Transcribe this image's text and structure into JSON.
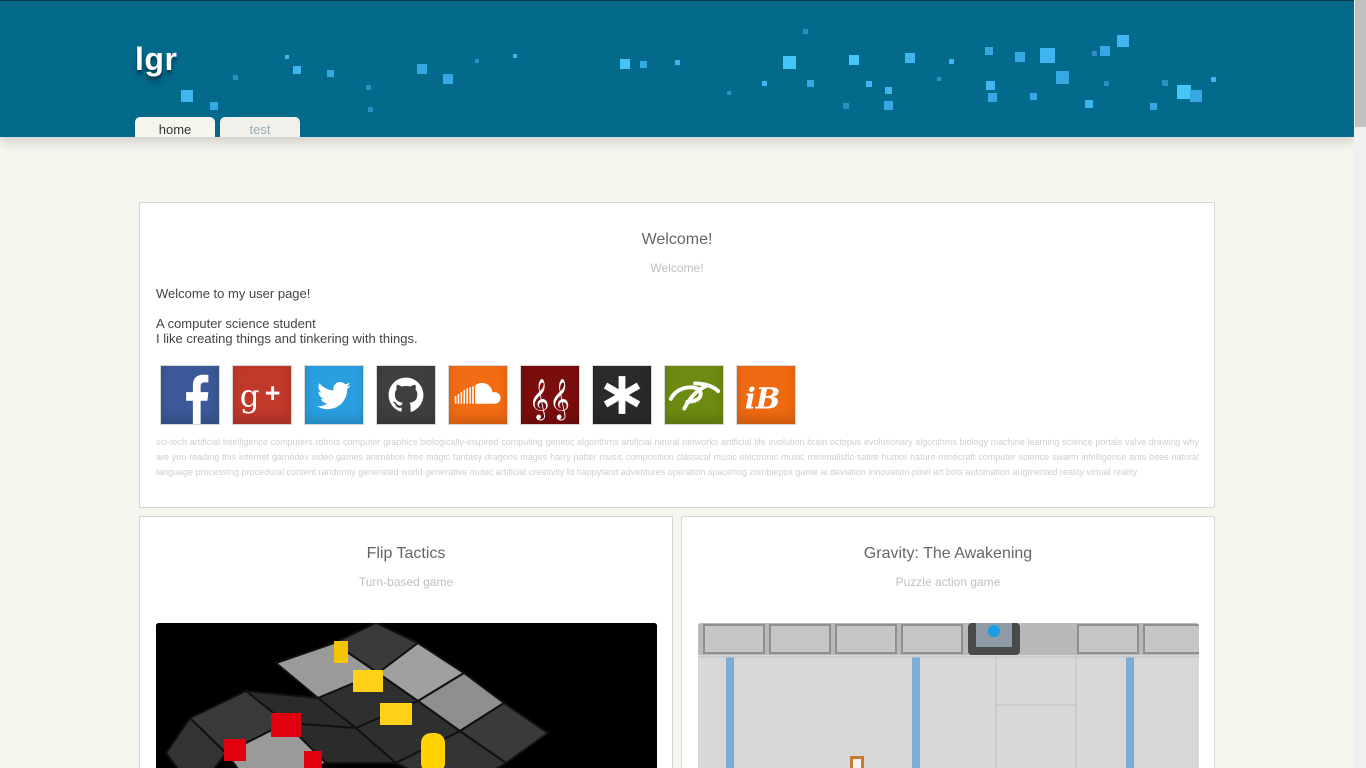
{
  "header": {
    "logo": "lgr",
    "tabs": [
      {
        "label": "home",
        "active": true
      },
      {
        "label": "test",
        "active": false
      }
    ],
    "accent_color": "#046a8c"
  },
  "welcome": {
    "title": "Welcome!",
    "subtitle": "Welcome!",
    "intro": "Welcome to my user page!",
    "line1": "A computer science student",
    "line2": "I like creating things and tinkering with things.",
    "socials": [
      {
        "name": "Facebook",
        "icon": "facebook-icon",
        "color": "#3b5998"
      },
      {
        "name": "Google+",
        "icon": "google-plus-icon",
        "color": "#c0392b"
      },
      {
        "name": "Twitter",
        "icon": "twitter-icon",
        "color": "#2a9fe0"
      },
      {
        "name": "GitHub",
        "icon": "github-icon",
        "color": "#3f3f3f"
      },
      {
        "name": "SoundCloud",
        "icon": "soundcloud-icon",
        "color": "#f26c13"
      },
      {
        "name": "Music",
        "icon": "treble-clef-icon",
        "color": "#7a0d0d"
      },
      {
        "name": "Asterisk",
        "icon": "asterisk-icon",
        "color": "#2a2a2a"
      },
      {
        "name": "deviantArt",
        "icon": "deviantart-icon",
        "color": "#6d8a12"
      },
      {
        "name": "iB",
        "icon": "ib-icon",
        "color": "#ee6a10"
      }
    ],
    "tags": "sci-tech artificial intelligence computers robots computer graphics biologically-inspired computing genetic algorithms artificial neural networks artificial life evolution brain octopus evolutionary algorithms biology machine learning science portals valve drawing why are you reading this internet gamedev video games animation free magic fantasy dragons mages harry patter music composition classical music electronic music minimalistic satire humor nature minecraft computer science swarm intelligence ants bees natural language processing procedural content randomly generated world generative music artificial creativity fd happyland adventures operation spacehog zombiepox game ai deviation innovation pixel art bots automation augmented reality virtual reality"
  },
  "games": [
    {
      "title": "Flip Tactics",
      "subtitle": "Turn-based game"
    },
    {
      "title": "Gravity: The Awakening",
      "subtitle": "Puzzle action game"
    }
  ]
}
